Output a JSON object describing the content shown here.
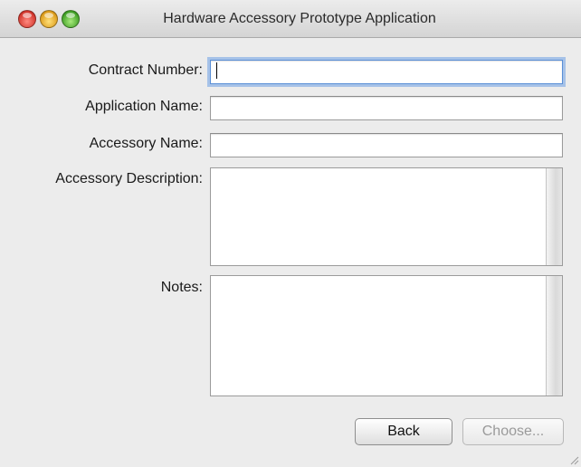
{
  "window": {
    "title": "Hardware Accessory Prototype Application"
  },
  "form": {
    "contract_number": {
      "label": "Contract Number:",
      "value": ""
    },
    "application_name": {
      "label": "Application Name:",
      "value": ""
    },
    "accessory_name": {
      "label": "Accessory Name:",
      "value": ""
    },
    "accessory_description": {
      "label": "Accessory Description:",
      "value": ""
    },
    "notes": {
      "label": "Notes:",
      "value": ""
    }
  },
  "buttons": {
    "back_label": "Back",
    "choose_label": "Choose..."
  },
  "colors": {
    "focus_ring": "#5a8fd6",
    "window_bg": "#ececec"
  }
}
